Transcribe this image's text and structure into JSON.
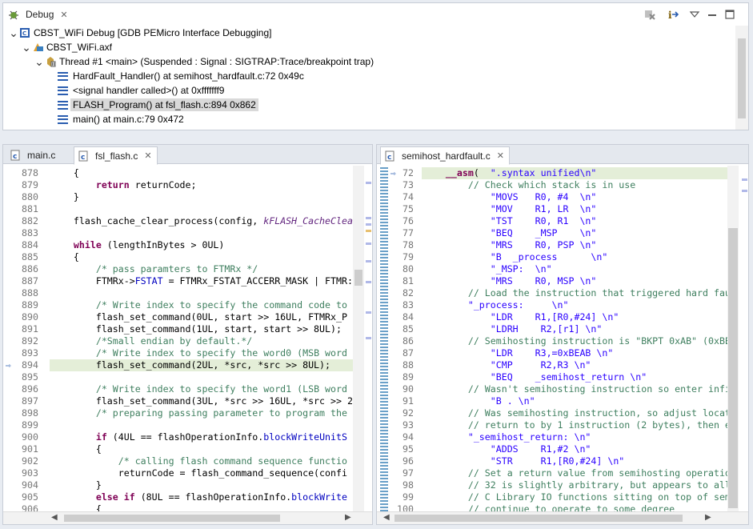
{
  "debug_view": {
    "tab_label": "Debug",
    "tree": [
      {
        "label": "CBST_WiFi Debug [GDB PEMicro Interface Debugging]",
        "level": 0,
        "icon": "launch-config-icon"
      },
      {
        "label": "CBST_WiFi.axf",
        "level": 1,
        "icon": "process-icon"
      },
      {
        "label": "Thread #1 <main> (Suspended : Signal : SIGTRAP:Trace/breakpoint trap)",
        "level": 2,
        "icon": "thread-icon"
      },
      {
        "label": "HardFault_Handler() at semihost_hardfault.c:72 0x49c",
        "level": 3,
        "icon": "stack-frame-icon"
      },
      {
        "label": "<signal handler called>() at 0xfffffff9",
        "level": 3,
        "icon": "stack-frame-icon"
      },
      {
        "label": "FLASH_Program() at fsl_flash.c:894 0x862",
        "level": 3,
        "icon": "stack-frame-icon",
        "selected": true
      },
      {
        "label": "main() at main.c:79 0x472",
        "level": 3,
        "icon": "stack-frame-icon"
      }
    ]
  },
  "left_editor": {
    "tabs": [
      {
        "label": "main.c",
        "active": false
      },
      {
        "label": "fsl_flash.c",
        "active": true
      }
    ],
    "current_line": "894",
    "lines": [
      {
        "n": "878",
        "html": "    {"
      },
      {
        "n": "879",
        "html": "        <span class=\"kw\">return</span> returnCode;"
      },
      {
        "n": "880",
        "html": "    }"
      },
      {
        "n": "881",
        "html": ""
      },
      {
        "n": "882",
        "html": "    flash_cache_clear_process(config, <span class=\"it\">kFLASH_CacheClea</span>"
      },
      {
        "n": "883",
        "html": ""
      },
      {
        "n": "884",
        "html": "    <span class=\"kw\">while</span> (lengthInBytes > 0UL)"
      },
      {
        "n": "885",
        "html": "    {"
      },
      {
        "n": "886",
        "html": "        <span class=\"cm\">/* pass paramters to FTMRx */</span>"
      },
      {
        "n": "887",
        "html": "        FTMRx-><span class=\"fld\">FSTAT</span> = FTMRx_FSTAT_ACCERR_MASK | FTMR:"
      },
      {
        "n": "888",
        "html": ""
      },
      {
        "n": "889",
        "html": "        <span class=\"cm\">/* Write index to specify the command code to</span>"
      },
      {
        "n": "890",
        "html": "        flash_set_command(0UL, start >> 16UL, FTMRx_P"
      },
      {
        "n": "891",
        "html": "        flash_set_command(1UL, start, start >> 8UL);"
      },
      {
        "n": "892",
        "html": "        <span class=\"cm\">/*Small endian by default.*/</span>"
      },
      {
        "n": "893",
        "html": "        <span class=\"cm\">/* Write index to specify the word0 (MSB word</span>"
      },
      {
        "n": "894",
        "html": "        flash_set_command(2UL, *src, *src >> 8UL);"
      },
      {
        "n": "895",
        "html": ""
      },
      {
        "n": "896",
        "html": "        <span class=\"cm\">/* Write index to specify the word1 (LSB word</span>"
      },
      {
        "n": "897",
        "html": "        flash_set_command(3UL, *src >> 16UL, *src >> 2"
      },
      {
        "n": "898",
        "html": "        <span class=\"cm\">/* preparing passing parameter to program the</span>"
      },
      {
        "n": "899",
        "html": ""
      },
      {
        "n": "900",
        "html": "        <span class=\"kw\">if</span> (4UL == flashOperationInfo.<span class=\"fld\">blockWriteUnitS</span>"
      },
      {
        "n": "901",
        "html": "        {"
      },
      {
        "n": "902",
        "html": "            <span class=\"cm\">/* calling flash command sequence functio</span>"
      },
      {
        "n": "903",
        "html": "            returnCode = flash_command_sequence(confi"
      },
      {
        "n": "904",
        "html": "        }"
      },
      {
        "n": "905",
        "html": "        <span class=\"kw\">else if</span> (8UL == flashOperationInfo.<span class=\"fld\">blockWrite</span>"
      },
      {
        "n": "906",
        "html": "        {"
      }
    ]
  },
  "right_editor": {
    "tabs": [
      {
        "label": "semihost_hardfault.c",
        "active": true
      }
    ],
    "current_line": "72",
    "lines": [
      {
        "n": "72",
        "html": "    <span class=\"kw\">__asm</span>(  <span class=\"st\">\".syntax unified\\n\"</span>"
      },
      {
        "n": "73",
        "html": "        <span class=\"cm\">// Check which stack is in use</span>"
      },
      {
        "n": "74",
        "html": "            <span class=\"st\">\"MOVS   R0, #4  \\n\"</span>"
      },
      {
        "n": "75",
        "html": "            <span class=\"st\">\"MOV    R1, LR  \\n\"</span>"
      },
      {
        "n": "76",
        "html": "            <span class=\"st\">\"TST    R0, R1  \\n\"</span>"
      },
      {
        "n": "77",
        "html": "            <span class=\"st\">\"BEQ    _MSP    \\n\"</span>"
      },
      {
        "n": "78",
        "html": "            <span class=\"st\">\"MRS    R0, PSP \\n\"</span>"
      },
      {
        "n": "79",
        "html": "            <span class=\"st\">\"B  _process      \\n\"</span>"
      },
      {
        "n": "80",
        "html": "            <span class=\"st\">\"_MSP:  \\n\"</span>"
      },
      {
        "n": "81",
        "html": "            <span class=\"st\">\"MRS    R0, MSP \\n\"</span>"
      },
      {
        "n": "82",
        "html": "        <span class=\"cm\">// Load the instruction that triggered hard fau</span>"
      },
      {
        "n": "83",
        "html": "        <span class=\"st\">\"_process:     \\n\"</span>"
      },
      {
        "n": "84",
        "html": "            <span class=\"st\">\"LDR    R1,[R0,#24] \\n\"</span>"
      },
      {
        "n": "85",
        "html": "            <span class=\"st\">\"LDRH    R2,[r1] \\n\"</span>"
      },
      {
        "n": "86",
        "html": "        <span class=\"cm\">// Semihosting instruction is \"BKPT 0xAB\" (0xBE</span>"
      },
      {
        "n": "87",
        "html": "            <span class=\"st\">\"LDR    R3,=0xBEAB \\n\"</span>"
      },
      {
        "n": "88",
        "html": "            <span class=\"st\">\"CMP     R2,R3 \\n\"</span>"
      },
      {
        "n": "89",
        "html": "            <span class=\"st\">\"BEQ    _semihost_return \\n\"</span>"
      },
      {
        "n": "90",
        "html": "        <span class=\"cm\">// Wasn't semihosting instruction so enter infi</span>"
      },
      {
        "n": "91",
        "html": "            <span class=\"st\">\"B . \\n\"</span>"
      },
      {
        "n": "92",
        "html": "        <span class=\"cm\">// Was semihosting instruction, so adjust locat</span>"
      },
      {
        "n": "93",
        "html": "        <span class=\"cm\">// return to by 1 instruction (2 bytes), then e</span>"
      },
      {
        "n": "94",
        "html": "        <span class=\"st\">\"_semihost_return: \\n\"</span>"
      },
      {
        "n": "95",
        "html": "            <span class=\"st\">\"ADDS    R1,#2 \\n\"</span>"
      },
      {
        "n": "96",
        "html": "            <span class=\"st\">\"STR     R1,[R0,#24] \\n\"</span>"
      },
      {
        "n": "97",
        "html": "        <span class=\"cm\">// Set a return value from semihosting operatio</span>"
      },
      {
        "n": "98",
        "html": "        <span class=\"cm\">// 32 is slightly arbitrary, but appears to all</span>"
      },
      {
        "n": "99",
        "html": "        <span class=\"cm\">// C Library IO functions sitting on top of sem</span>"
      },
      {
        "n": "100",
        "html": "        <span class=\"cm\">// continue to operate to some degree</span>"
      }
    ]
  },
  "colors": {
    "current_line_bg": "#e4eed8",
    "keyword": "#7f0055",
    "comment": "#3f7f5f",
    "string": "#2a00ff",
    "accent": "#2a5db0"
  }
}
